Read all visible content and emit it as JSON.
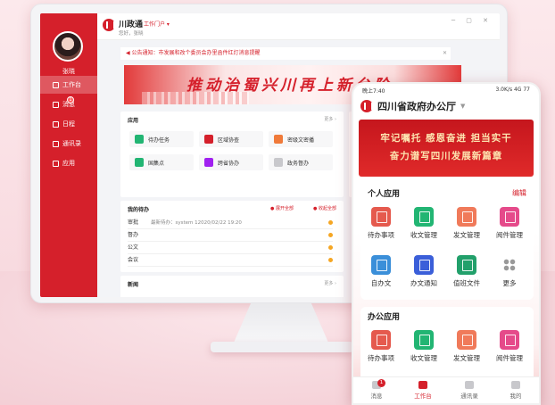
{
  "desktop": {
    "sidebar": {
      "user_name": "张晓",
      "items": [
        {
          "label": "工作台",
          "active": true
        },
        {
          "label": "消息",
          "badge": "1"
        },
        {
          "label": "日程"
        },
        {
          "label": "通讯录"
        },
        {
          "label": "应用"
        }
      ]
    },
    "header": {
      "app_title": "川政通",
      "portal": "工作门户 ▾",
      "greeting": "您好，张晓",
      "window_controls": "─ ▢ ✕"
    },
    "notice": {
      "text": "◀ 公告通知：市发展和改个委员会办里函件红灯消息提醒",
      "close": "✕"
    },
    "banner": {
      "slogan": "推动治蜀兴川再上新台阶"
    },
    "apps_panel": {
      "title": "应用",
      "more": "更多 ›",
      "tiles": [
        {
          "label": "待办任务",
          "color": "#22b573"
        },
        {
          "label": "区域协查",
          "color": "#d5202b"
        },
        {
          "label": "密级文密播",
          "color": "#f07a3a"
        },
        {
          "label": "国集点",
          "color": "#22b573"
        },
        {
          "label": "跨省协办",
          "color": "#a020f0"
        },
        {
          "label": "政务督办",
          "color": "#c8c8cc"
        }
      ]
    },
    "todo_panel": {
      "title": "我的待办",
      "action1": "● 展开全部",
      "action2": "● 收起全部",
      "rows": [
        {
          "label": "审批",
          "meta": "最新待办：system 12020/02/22 19:20"
        },
        {
          "label": "督办",
          "meta": ""
        },
        {
          "label": "公文",
          "meta": ""
        },
        {
          "label": "会议",
          "meta": ""
        }
      ]
    },
    "news_panel": {
      "title": "新闻",
      "more": "更多 ›"
    }
  },
  "mobile": {
    "status": {
      "time": "晚上7:40",
      "right": "3.0K/s 4G 77"
    },
    "title": "四川省政府办公厅",
    "banner_line1": "牢记嘱托 感恩奋进 担当实干",
    "banner_line2": "奋力谱写四川发展新篇章",
    "personal": {
      "title": "个人应用",
      "edit": "编辑",
      "apps": [
        {
          "label": "待办事项",
          "color": "#e55a4e"
        },
        {
          "label": "收文管理",
          "color": "#22b573"
        },
        {
          "label": "发文管理",
          "color": "#f07a5a"
        },
        {
          "label": "阅件管理",
          "color": "#e54a8a"
        },
        {
          "label": "自办文",
          "color": "#3b8fd9"
        },
        {
          "label": "办文通知",
          "color": "#3b5fd9"
        },
        {
          "label": "值班文件",
          "color": "#22a06b"
        },
        {
          "label": "更多",
          "color": "#999999"
        }
      ]
    },
    "office": {
      "title": "办公应用",
      "apps": [
        {
          "label": "待办事项",
          "color": "#e55a4e"
        },
        {
          "label": "收文管理",
          "color": "#22b573"
        },
        {
          "label": "发文管理",
          "color": "#f07a5a"
        },
        {
          "label": "阅件管理",
          "color": "#e54a8a"
        }
      ]
    },
    "tabs": [
      {
        "label": "消息",
        "badge": "1"
      },
      {
        "label": "工作台",
        "active": true
      },
      {
        "label": "通讯录"
      },
      {
        "label": "我的"
      }
    ]
  }
}
